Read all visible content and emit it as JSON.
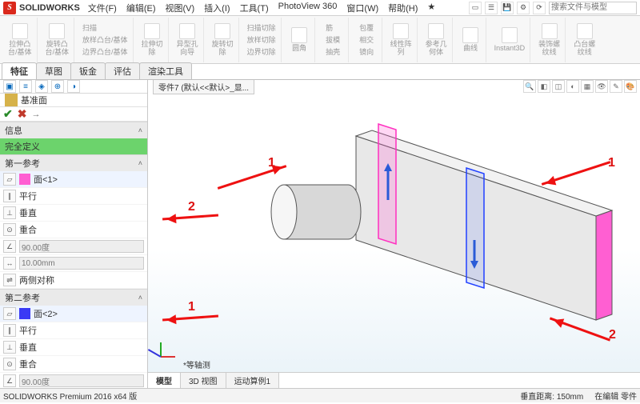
{
  "app": {
    "logo": "S",
    "name": "SOLIDWORKS"
  },
  "menu": {
    "file": "文件(F)",
    "edit": "编辑(E)",
    "view": "视图(V)",
    "insert": "插入(I)",
    "tools": "工具(T)",
    "pv": "PhotoView 360",
    "window": "窗口(W)",
    "help": "帮助(H)",
    "star": "★"
  },
  "search_ph": "搜索文件与模型",
  "ribbon": {
    "g1": {
      "a": "拉伸凸",
      "b": "台/基体"
    },
    "g2": {
      "a": "旋转凸",
      "b": "台/基体"
    },
    "c1a": "扫描",
    "c1b": "放样凸台/基体",
    "c1c": "边界凸台/基体",
    "g3": {
      "a": "拉伸切",
      "b": "除"
    },
    "g4": {
      "a": "异型孔",
      "b": "向导"
    },
    "g5": {
      "a": "旋转切",
      "b": "除"
    },
    "c2a": "扫描切除",
    "c2b": "放样切除",
    "c2c": "边界切除",
    "g6": "圆角",
    "c3a": "筋",
    "c3b": "拔模",
    "c3c": "抽壳",
    "c4a": "包覆",
    "c4b": "相交",
    "c4c": "镜向",
    "g7": {
      "a": "线性阵",
      "b": "列"
    },
    "g8": {
      "a": "参考几",
      "b": "何体"
    },
    "g9": "曲线",
    "g10": "Instant3D",
    "g11": {
      "a": "装饰螺",
      "b": "纹线"
    },
    "g12": {
      "a": "凸台螺",
      "b": "纹线"
    }
  },
  "ctabs": {
    "t1": "特征",
    "t2": "草图",
    "t3": "钣金",
    "t4": "评估",
    "t5": "渲染工具"
  },
  "pm": {
    "title": "基准面",
    "info_h": "信息",
    "info_v": "完全定义",
    "ref1_h": "第一参考",
    "ref1_sel": "面<1>",
    "p_par": "平行",
    "p_perp": "垂直",
    "p_coi": "重合",
    "ang": "90.00度",
    "dist": "10.00mm",
    "sym": "两侧对称",
    "ref2_h": "第二参考",
    "ref2_sel": "面<2>"
  },
  "doc_tab": "零件7 (默认<<默认>_显...",
  "iso_lbl": "*等轴测",
  "btabs": {
    "b1": "模型",
    "b2": "3D 视图",
    "b3": "运动算例1"
  },
  "status": {
    "app": "SOLIDWORKS Premium 2016 x64 版",
    "dist": "垂直距离: 150mm",
    "mode": "在编辑 零件"
  },
  "ann": {
    "n1": "1",
    "n2": "2"
  }
}
